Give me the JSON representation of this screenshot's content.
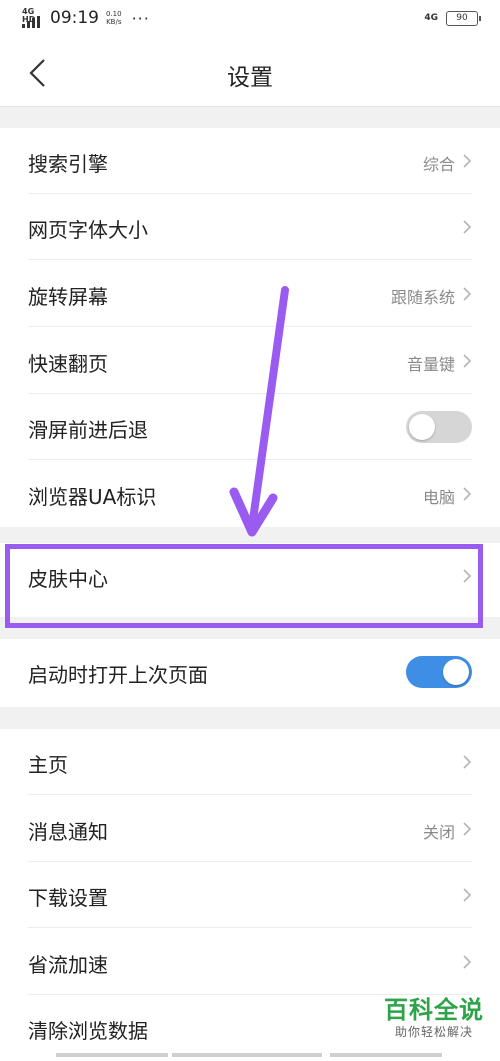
{
  "status_bar": {
    "network_tag": "4G HD",
    "time": "09:19",
    "speed_value": "0.10",
    "speed_unit": "KB/s",
    "more_dots": "···",
    "right_network": "4G",
    "battery": "90"
  },
  "nav": {
    "title": "设置",
    "back_icon": "chevron-left-icon"
  },
  "settings": [
    {
      "label": "搜索引擎",
      "value": "综合",
      "chevron": true
    },
    {
      "label": "网页字体大小",
      "value": "",
      "chevron": true
    },
    {
      "label": "旋转屏幕",
      "value": "跟随系统",
      "chevron": true
    },
    {
      "label": "快速翻页",
      "value": "音量键",
      "chevron": true
    },
    {
      "label": "滑屏前进后退",
      "toggle": false
    },
    {
      "label": "浏览器UA标识",
      "value": "电脑",
      "chevron": true
    },
    {
      "label": "皮肤中心",
      "value": "",
      "chevron": true,
      "highlighted": true
    },
    {
      "label": "启动时打开上次页面",
      "toggle": true
    },
    {
      "label": "主页",
      "value": "",
      "chevron": true
    },
    {
      "label": "消息通知",
      "value": "关闭",
      "chevron": true
    },
    {
      "label": "下载设置",
      "value": "",
      "chevron": true
    },
    {
      "label": "省流加速",
      "value": "",
      "chevron": true
    },
    {
      "label": "清除浏览数据",
      "value": "",
      "chevron": false
    }
  ],
  "annotation": {
    "highlight_color": "#9a5cf0",
    "arrow_color": "#9a5cf0"
  },
  "toggle_on_color": "#3f8ee6",
  "watermark": {
    "title": "百科全说",
    "subtitle": "助你轻松解决"
  }
}
